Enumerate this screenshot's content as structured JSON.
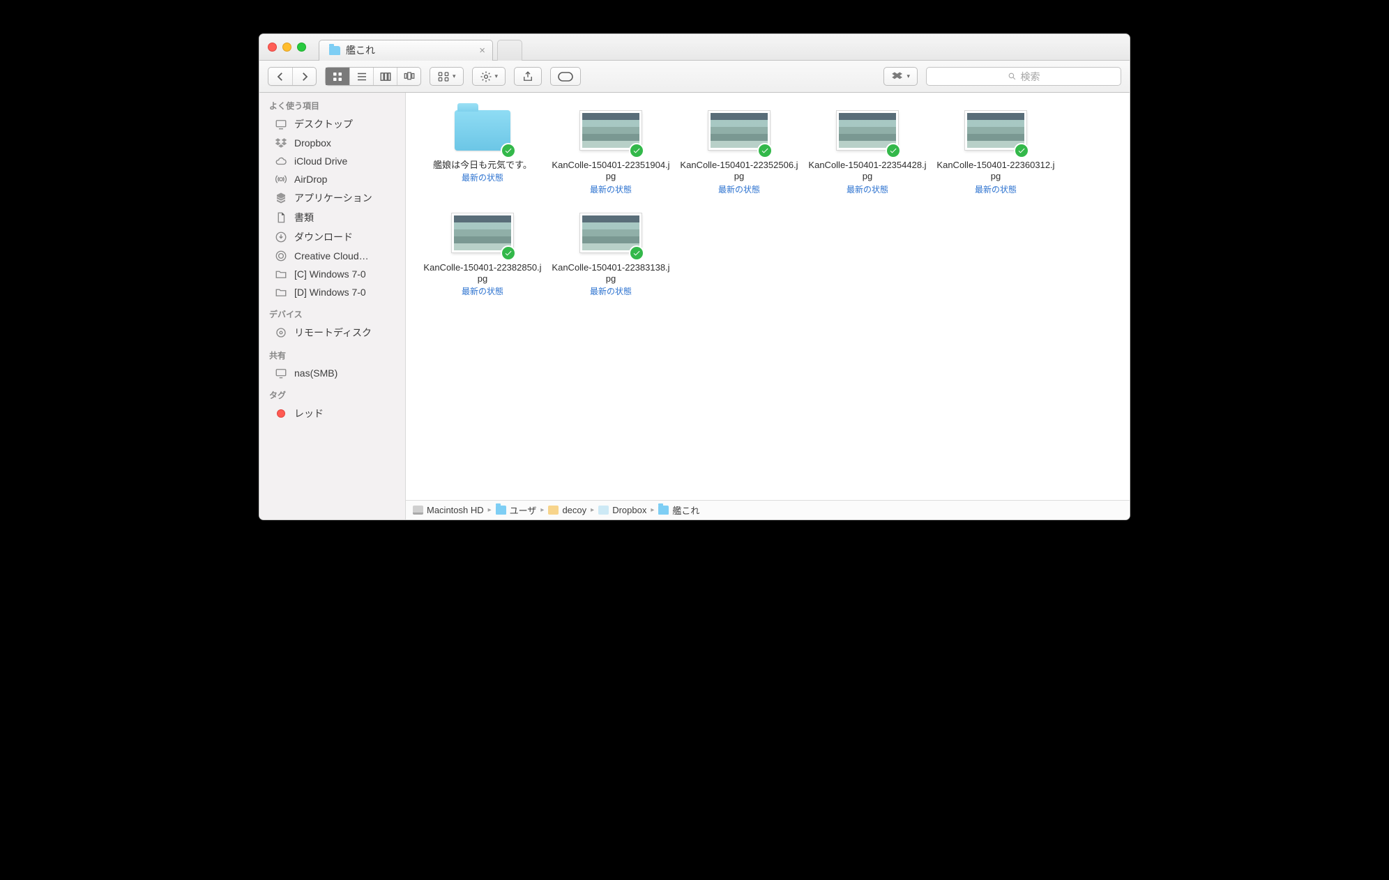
{
  "tab": {
    "title": "艦これ"
  },
  "toolbar": {
    "search_placeholder": "検索"
  },
  "sidebar": {
    "sections": [
      {
        "title": "よく使う項目",
        "items": [
          {
            "label": "デスクトップ",
            "icon": "desktop"
          },
          {
            "label": "Dropbox",
            "icon": "dropbox"
          },
          {
            "label": "iCloud Drive",
            "icon": "cloud"
          },
          {
            "label": "AirDrop",
            "icon": "airdrop"
          },
          {
            "label": "アプリケーション",
            "icon": "apps"
          },
          {
            "label": "書類",
            "icon": "doc"
          },
          {
            "label": "ダウンロード",
            "icon": "download"
          },
          {
            "label": "Creative Cloud…",
            "icon": "cc"
          },
          {
            "label": "[C] Windows 7-0",
            "icon": "folder"
          },
          {
            "label": "[D] Windows 7-0",
            "icon": "folder"
          }
        ]
      },
      {
        "title": "デバイス",
        "items": [
          {
            "label": "リモートディスク",
            "icon": "disc"
          }
        ]
      },
      {
        "title": "共有",
        "items": [
          {
            "label": "nas(SMB)",
            "icon": "display"
          }
        ]
      },
      {
        "title": "タグ",
        "items": [
          {
            "label": "レッド",
            "icon": "tag-red"
          }
        ]
      }
    ]
  },
  "files": [
    {
      "type": "folder",
      "name": "艦娘は今日も元気です。",
      "status": "最新の状態"
    },
    {
      "type": "image",
      "name": "KanColle-150401-22351904.jpg",
      "status": "最新の状態"
    },
    {
      "type": "image",
      "name": "KanColle-150401-22352506.jpg",
      "status": "最新の状態"
    },
    {
      "type": "image",
      "name": "KanColle-150401-22354428.jpg",
      "status": "最新の状態"
    },
    {
      "type": "image",
      "name": "KanColle-150401-22360312.jpg",
      "status": "最新の状態"
    },
    {
      "type": "image",
      "name": "KanColle-150401-22382850.jpg",
      "status": "最新の状態"
    },
    {
      "type": "image",
      "name": "KanColle-150401-22383138.jpg",
      "status": "最新の状態"
    }
  ],
  "path": [
    {
      "label": "Macintosh HD",
      "icon": "hd"
    },
    {
      "label": "ユーザ",
      "icon": "fp"
    },
    {
      "label": "decoy",
      "icon": "home"
    },
    {
      "label": "Dropbox",
      "icon": "db"
    },
    {
      "label": "艦これ",
      "icon": "fp"
    }
  ]
}
